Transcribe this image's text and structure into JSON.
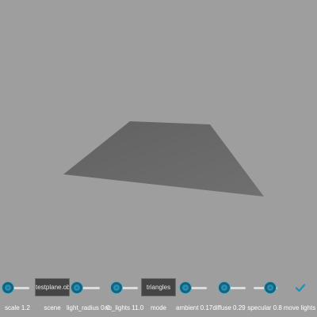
{
  "colors": {
    "background": "#9e9e9e",
    "plane_fill": "#6a6a6a",
    "accent": "#1f8fb5"
  },
  "controls": {
    "scale": {
      "label": "scale 1.2",
      "value_fraction": 0.0
    },
    "scene": {
      "label": "scene",
      "selected": "testplane.obj"
    },
    "light_radius": {
      "label": "light_radius 0.0",
      "value_fraction": 0.0
    },
    "nb_lights": {
      "label": "nb_lights 11.0",
      "value_fraction": 0.0
    },
    "mode": {
      "label": "mode",
      "selected": "triangles"
    },
    "ambient": {
      "label": "ambient 0.17",
      "value_fraction": 0.0
    },
    "diffuse": {
      "label": "diffuse 0.29",
      "value_fraction": 0.0
    },
    "specular": {
      "label": "specular 0.8",
      "value_fraction": 0.75
    },
    "move_lights": {
      "label": "move lights",
      "checked": true,
      "icon": "checkmark-icon"
    }
  }
}
